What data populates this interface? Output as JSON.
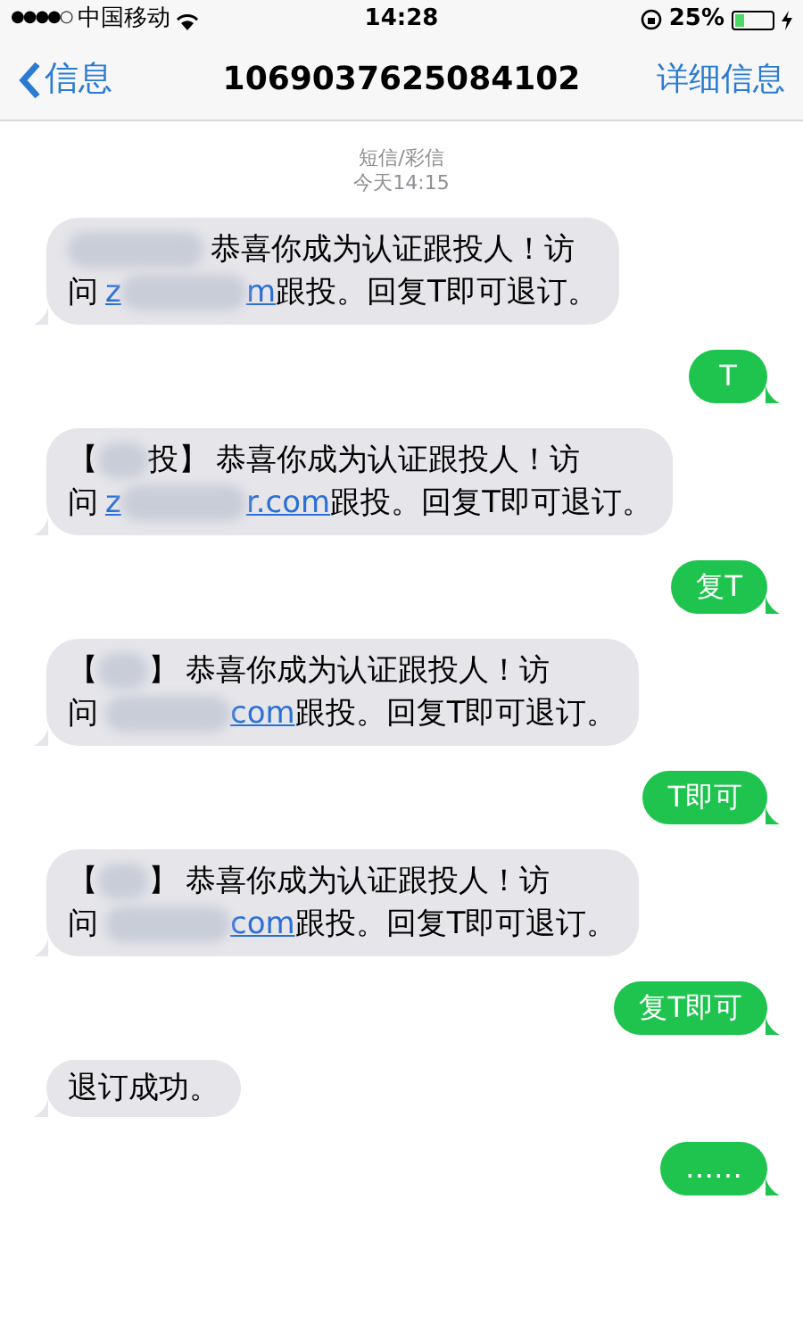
{
  "status_bar": {
    "signal": "●●●●○",
    "carrier": "中国移动",
    "time": "14:28",
    "battery": "25%"
  },
  "nav": {
    "back": "信息",
    "title": "1069037625084102",
    "details": "详细信息"
  },
  "header": {
    "service": "短信/彩信",
    "timestamp": "今天14:15"
  },
  "messages": [
    {
      "kind": "received",
      "body": "恭喜你成为认证跟投人！访",
      "lead": "问",
      "link_start": "z",
      "link_end": "m",
      "suffix": "跟投。回复T即可退订。"
    },
    {
      "kind": "sent",
      "text": "T"
    },
    {
      "kind": "received",
      "prefix_start": "【",
      "prefix_end": "投】",
      "body": "恭喜你成为认证跟投人！访",
      "lead": "问",
      "link_start": "z",
      "link_end": "r.com",
      "suffix": "跟投。回复T即可退订。"
    },
    {
      "kind": "sent",
      "text": "复T"
    },
    {
      "kind": "received",
      "prefix_start": "【",
      "prefix_end": "】",
      "body": "恭喜你成为认证跟投人！访",
      "lead": "问",
      "link_end": "com",
      "suffix": "跟投。回复T即可退订。"
    },
    {
      "kind": "sent",
      "text": "T即可"
    },
    {
      "kind": "received",
      "prefix_start": "【",
      "prefix_end": "】",
      "body": "恭喜你成为认证跟投人！访",
      "lead": "问",
      "link_end": "com",
      "suffix": "跟投。回复T即可退订。"
    },
    {
      "kind": "sent",
      "text": "复T即可"
    },
    {
      "kind": "received_plain",
      "text": "退订成功。"
    },
    {
      "kind": "sent",
      "text": "……"
    }
  ]
}
